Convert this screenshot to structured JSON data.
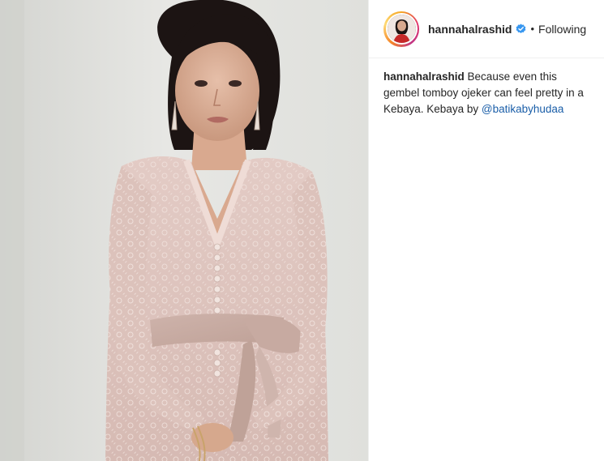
{
  "post": {
    "username": "hannahalrashid",
    "verified": true,
    "separator": "•",
    "follow_status": "Following",
    "caption": {
      "username": "hannahalrashid",
      "text": "Because even this gembel tomboy ojeker can feel pretty in a Kebaya. Kebaya by",
      "mention": "@batikabyhudaa"
    }
  },
  "colors": {
    "verified_badge": "#3897f0",
    "mention_link": "#1a5ea8",
    "text": "#262626",
    "avatar_ring": [
      "#feda75",
      "#f58529",
      "#e1306c",
      "#c13584"
    ]
  },
  "icons": {
    "verified": "verified-badge-icon"
  },
  "photo": {
    "subject": "woman in a pink lace kebaya"
  }
}
